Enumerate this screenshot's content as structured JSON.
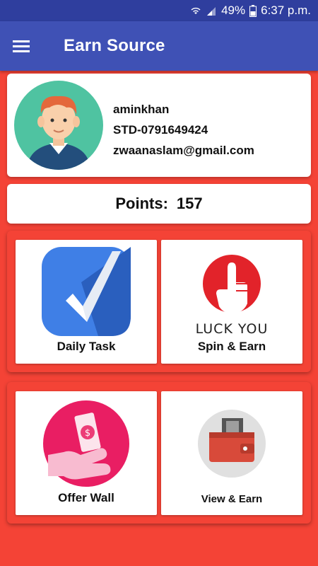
{
  "status_bar": {
    "battery": "49%",
    "time": "6:37 p.m."
  },
  "app_bar": {
    "title": "Earn Source"
  },
  "profile": {
    "username": "aminkhan",
    "phone": "STD-0791649424",
    "email": "zwaanaslam@gmail.com"
  },
  "points": {
    "label": "Points:",
    "value": "157"
  },
  "tiles": [
    {
      "label": "Daily Task",
      "icon": "checkmark-icon"
    },
    {
      "label": "Spin & Earn",
      "icon": "spin-icon",
      "caption": "LUCK YOU"
    },
    {
      "label": "Offer Wall",
      "icon": "money-hand-icon"
    },
    {
      "label": "View & Earn",
      "icon": "wallet-icon"
    }
  ],
  "colors": {
    "primary": "#3f51b5",
    "status_bar": "#2f3e9e",
    "background": "#f44336"
  }
}
